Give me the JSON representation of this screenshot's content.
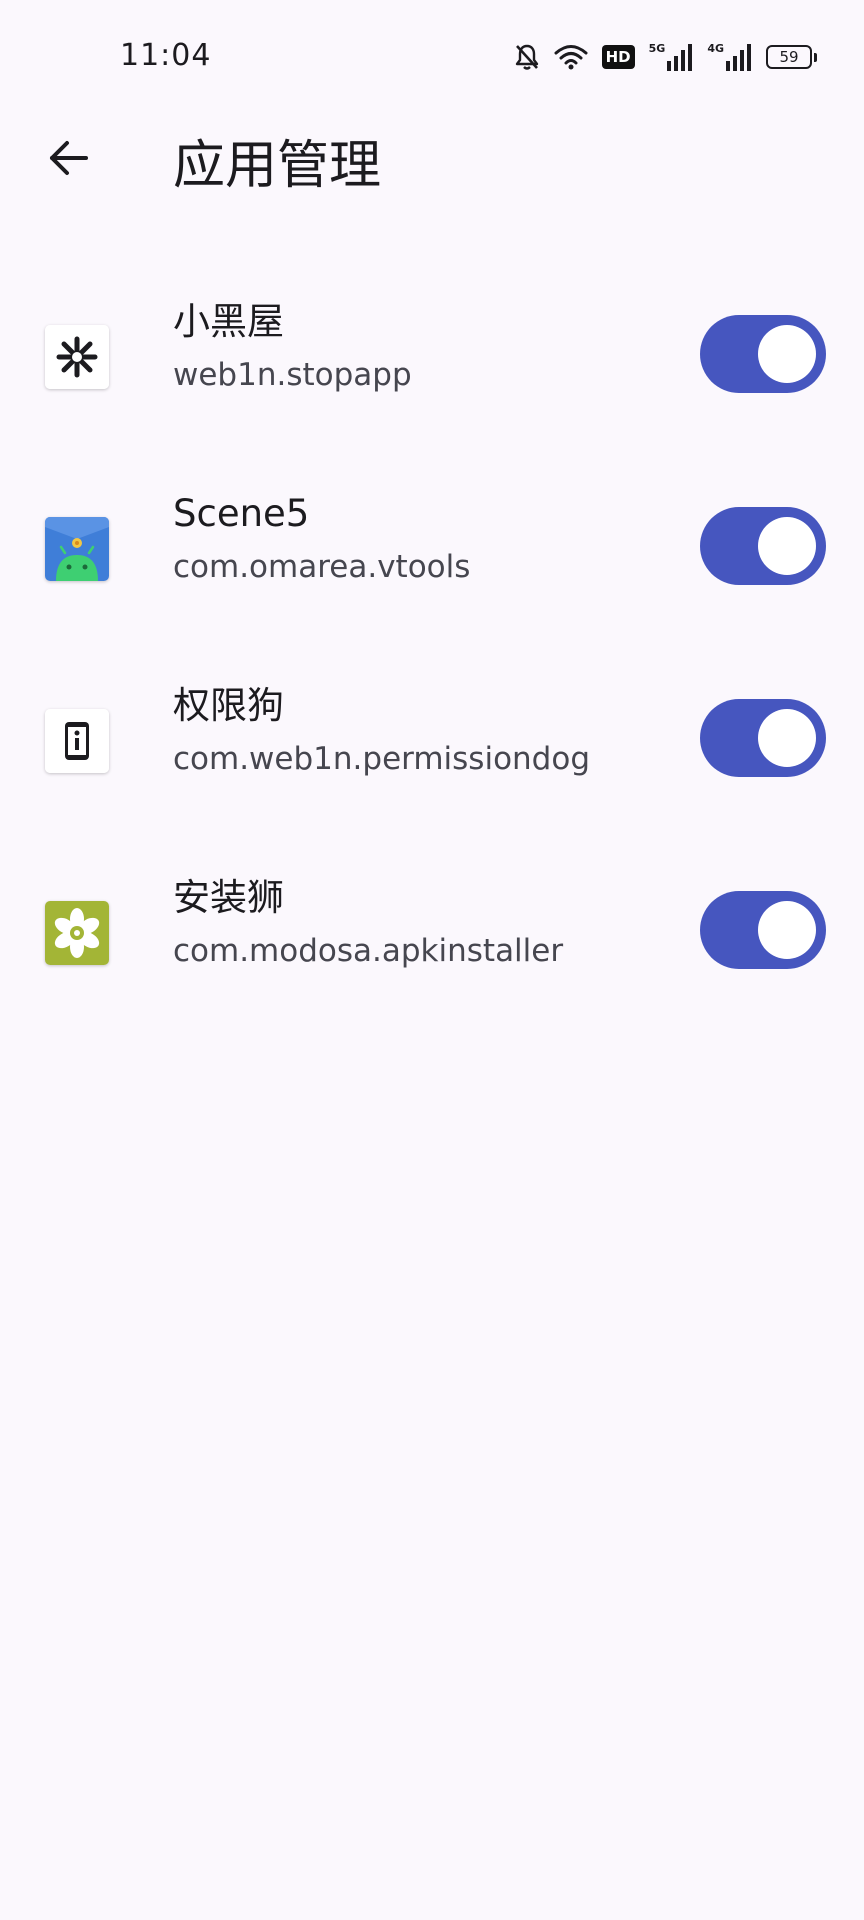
{
  "status_bar": {
    "time": "11:04",
    "icons": [
      "bell-off-icon",
      "wifi-icon",
      "hd-icon",
      "signal-5g-icon",
      "signal-4g-icon",
      "battery-icon"
    ],
    "hd_label": "HD",
    "net1_label": "5G",
    "net2_label": "4G",
    "battery_level": "59"
  },
  "header": {
    "back_icon": "arrow-left-icon",
    "title": "应用管理"
  },
  "apps": [
    {
      "name": "小黑屋",
      "package": "web1n.stopapp",
      "enabled": true,
      "icon": "snowflake-icon",
      "icon_bg": "#ffffff"
    },
    {
      "name": "Scene5",
      "package": "com.omarea.vtools",
      "enabled": true,
      "icon": "android-icon",
      "icon_bg": "#3f7ed8"
    },
    {
      "name": "权限狗",
      "package": "com.web1n.permissiondog",
      "enabled": true,
      "icon": "phone-info-icon",
      "icon_bg": "#ffffff"
    },
    {
      "name": "安装狮",
      "package": "com.modosa.apkinstaller",
      "enabled": true,
      "icon": "flower-icon",
      "icon_bg": "#a3b536"
    }
  ],
  "colors": {
    "background": "#fbf8fd",
    "toggle_on": "#4656bf",
    "text_primary": "#1c1b1f",
    "text_secondary": "#46464f"
  }
}
